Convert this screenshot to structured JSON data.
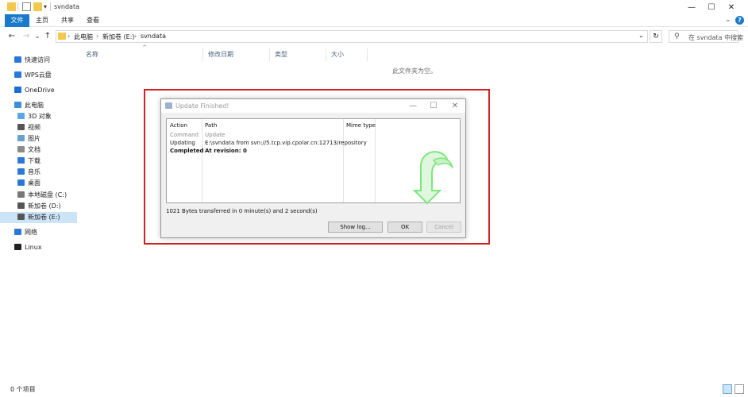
{
  "window": {
    "title": "svndata",
    "controls": {
      "minimize": "—",
      "maximize": "☐",
      "close": "✕",
      "chevron": "⌄",
      "help": "?"
    }
  },
  "ribbon": {
    "tabs": [
      "文件",
      "主页",
      "共享",
      "查看"
    ]
  },
  "nav": {
    "back": "←",
    "forward": "→",
    "recent": "⌄",
    "up": "↑",
    "breadcrumb": [
      "此电脑",
      "新加卷 (E:)",
      "svndata"
    ],
    "separator": "›",
    "dropdown": "⌄",
    "refresh": "↻",
    "search_placeholder": "在 svndata 中搜索"
  },
  "sidebar": {
    "items": [
      {
        "label": "快速访问",
        "icon": "star-icon",
        "color": "#2b78d8"
      },
      {
        "label": "WPS云盘",
        "icon": "cloud-icon",
        "color": "#2b78d8"
      },
      {
        "label": "OneDrive",
        "icon": "onedrive-icon",
        "color": "#1a6fd0"
      },
      {
        "label": "此电脑",
        "icon": "computer-icon",
        "color": "#3c8fd8"
      },
      {
        "label": "3D 对象",
        "icon": "3d-objects-icon",
        "color": "#5aa7e8"
      },
      {
        "label": "视频",
        "icon": "video-icon",
        "color": "#555555"
      },
      {
        "label": "图片",
        "icon": "pictures-icon",
        "color": "#6aa0cc"
      },
      {
        "label": "文档",
        "icon": "documents-icon",
        "color": "#8a8a8a"
      },
      {
        "label": "下载",
        "icon": "downloads-icon",
        "color": "#2b78d8"
      },
      {
        "label": "音乐",
        "icon": "music-icon",
        "color": "#2b78d8"
      },
      {
        "label": "桌面",
        "icon": "desktop-icon",
        "color": "#2b78d8"
      },
      {
        "label": "本地磁盘 (C:)",
        "icon": "drive-c-icon",
        "color": "#777777"
      },
      {
        "label": "新加卷 (D:)",
        "icon": "drive-d-icon",
        "color": "#555555"
      },
      {
        "label": "新加卷 (E:)",
        "icon": "drive-e-icon",
        "color": "#555555",
        "selected": true
      },
      {
        "label": "网络",
        "icon": "network-icon",
        "color": "#2b78d8"
      },
      {
        "label": "Linux",
        "icon": "linux-icon",
        "color": "#222222"
      }
    ]
  },
  "content": {
    "columns": [
      "名称",
      "修改日期",
      "类型",
      "大小"
    ],
    "sort_indicator": "^",
    "empty_message": "此文件夹为空。"
  },
  "status": {
    "item_count": "0 个项目"
  },
  "dialog": {
    "title": "Update Finished!",
    "controls": {
      "minimize": "—",
      "maximize": "☐",
      "close": "✕"
    },
    "headers": [
      "Action",
      "Path",
      "Mime type"
    ],
    "rows": [
      {
        "action": "Command",
        "path": "Update",
        "style": "gray"
      },
      {
        "action": "Updating",
        "path": "E:\\svndata from svn://5.tcp.vip.cpolar.cn:12713/repository",
        "style": "normal"
      },
      {
        "action": "Completed",
        "path": "At revision: 0",
        "style": "bold"
      }
    ],
    "transfer_text": "1021 Bytes transferred in 0 minute(s) and 2 second(s)",
    "buttons": {
      "show_log": "Show log...",
      "ok": "OK",
      "cancel": "Cancel"
    },
    "icon": "update-arrow-icon",
    "accent": "#7ee67e"
  }
}
